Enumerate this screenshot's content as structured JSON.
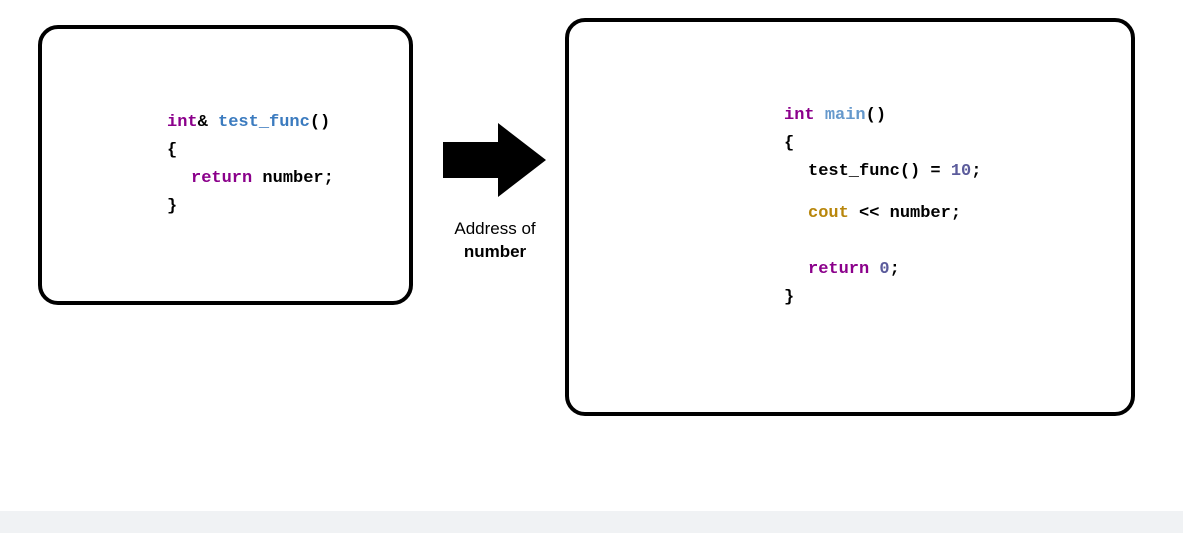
{
  "left_box": {
    "line1": {
      "int": "int",
      "amp": "& ",
      "func": "test_func",
      "paren": "()"
    },
    "line2": "{",
    "line3": {
      "return": "return",
      "rest": " number;"
    },
    "line4": "}"
  },
  "arrow": {
    "caption_line1": "Address of",
    "caption_line2": "number"
  },
  "right_box": {
    "line1": {
      "int": "int",
      "sp": " ",
      "main": "main",
      "paren": "()"
    },
    "line2": "{",
    "line3": {
      "func": "test_func",
      "rest": "() = ",
      "num": "10",
      "semi": ";"
    },
    "line4": {
      "cout": "cout",
      "op": " << ",
      "var": "number;"
    },
    "line5": {
      "return": "return",
      "sp": " ",
      "num": "0",
      "semi": ";"
    },
    "line6": "}"
  }
}
